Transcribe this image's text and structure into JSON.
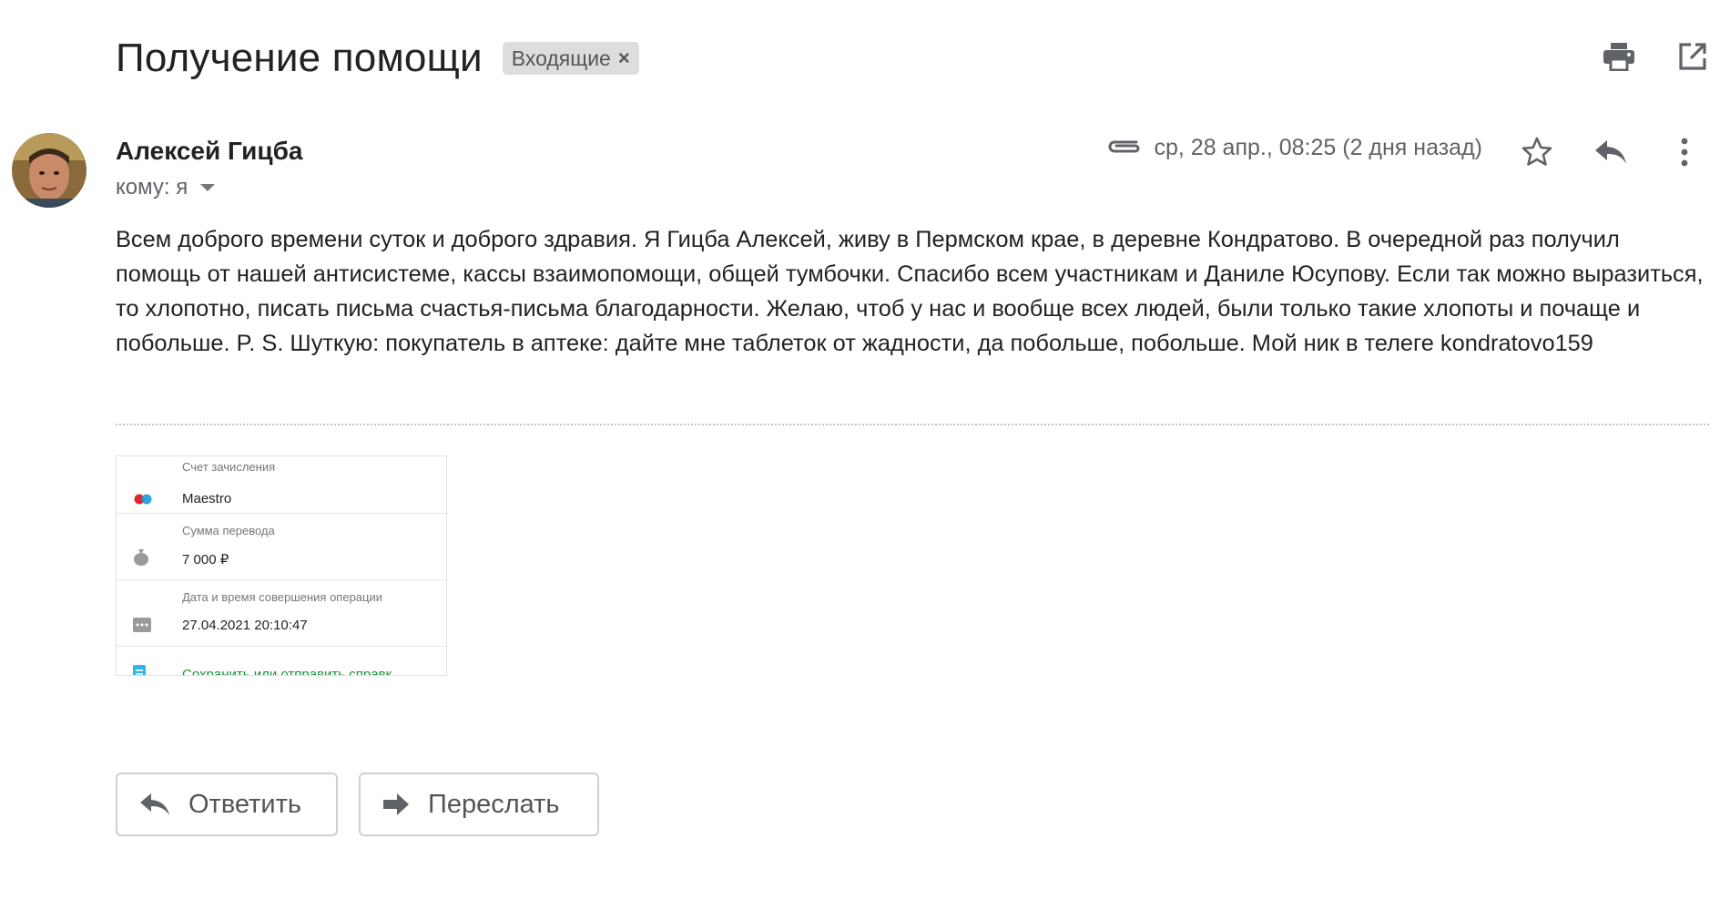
{
  "email": {
    "subject": "Получение помощи",
    "label": "Входящие",
    "label_remove": "×",
    "sender_name": "Алексей Гицба",
    "to_label": "кому: я",
    "date": "ср, 28 апр., 08:25 (2 дня назад)",
    "body": "Всем доброго времени суток и доброго здравия. Я Гицба Алексей, живу в Пермском крае, в деревне Кондратово. В очередной раз получил помощь от нашей антисистеме, кассы взаимопомощи, общей тумбочки. Спасибо всем участникам и Даниле Юсупову. Если так можно выразиться, то хлопотно, писать письма счастья-письма благодарности. Желаю, чтоб у нас и вообще всех людей, были только такие хлопоты и почаще и побольше. P. S. Шуткую: покупатель в аптеке: дайте мне таблеток от жадности, да побольше, побольше. Мой ник в телеге kondratovo159"
  },
  "attachment": {
    "account_caption": "Счет зачисления",
    "account_value": "Maestro",
    "amount_caption": "Сумма перевода",
    "amount_value": "7 000 ₽",
    "datetime_caption": "Дата и время совершения операции",
    "datetime_value": "27.04.2021 20:10:47",
    "link": "Сохранить или отправить справк"
  },
  "actions": {
    "reply": "Ответить",
    "forward": "Переслать"
  },
  "icons": {
    "print": "print-icon",
    "open_new_window": "open-in-new-window-icon",
    "attachment": "paperclip-icon",
    "star": "star-icon",
    "reply": "reply-icon",
    "more": "more-vert-icon",
    "forward": "forward-icon"
  },
  "colors": {
    "link_green": "#1a8f3a",
    "chip_bg": "#dddddd",
    "icon_grey": "#5f6368"
  }
}
